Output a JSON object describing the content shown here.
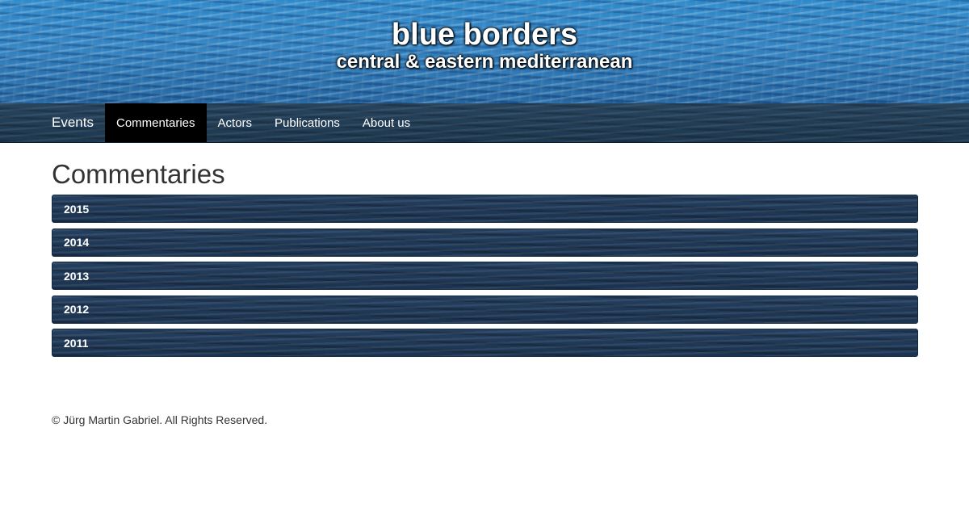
{
  "header": {
    "title": "blue borders",
    "subtitle": "central & eastern mediterranean"
  },
  "nav": {
    "items": [
      {
        "label": "Events",
        "active": false
      },
      {
        "label": "Commentaries",
        "active": true
      },
      {
        "label": "Actors",
        "active": false
      },
      {
        "label": "Publications",
        "active": false
      },
      {
        "label": "About us",
        "active": false
      }
    ]
  },
  "main": {
    "title": "Commentaries",
    "years": [
      "2015",
      "2014",
      "2013",
      "2012",
      "2011"
    ]
  },
  "footer": {
    "text": "© Jürg Martin Gabriel. All Rights Reserved."
  },
  "colors": {
    "nav_active_bg": "#000000",
    "panel_bg": "#1d3a5c",
    "banner_water": "#2f7fbf"
  }
}
